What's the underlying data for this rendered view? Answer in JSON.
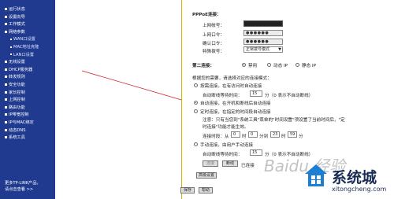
{
  "sidebar": {
    "items": [
      {
        "label": "运行状态",
        "sub": false
      },
      {
        "label": "设置向导",
        "sub": false
      },
      {
        "label": "工作模式",
        "sub": false
      },
      {
        "label": "网络参数",
        "sub": false
      },
      {
        "label": "WAN口设置",
        "sub": true
      },
      {
        "label": "MAC地址克隆",
        "sub": true
      },
      {
        "label": "LAN口设置",
        "sub": true
      },
      {
        "label": "无线设置",
        "sub": false
      },
      {
        "label": "DHCP服务器",
        "sub": false
      },
      {
        "label": "转发规则",
        "sub": false
      },
      {
        "label": "安全功能",
        "sub": false
      },
      {
        "label": "家长控制",
        "sub": false
      },
      {
        "label": "上网控制",
        "sub": false
      },
      {
        "label": "路由功能",
        "sub": false
      },
      {
        "label": "IP带宽控制",
        "sub": false
      },
      {
        "label": "IP与MAC绑定",
        "sub": false
      },
      {
        "label": "动态DNS",
        "sub": false
      },
      {
        "label": "系统工具",
        "sub": false
      }
    ],
    "footer_line1": "更多TP-LINK产品，",
    "footer_line2": "请点击查看 >>"
  },
  "form": {
    "pppoe_title": "PPPoE连接：",
    "account_label": "上网帐号：",
    "account_value": "",
    "password_label": "上网口令：",
    "password_value": "●●●●●●",
    "confirm_label": "确认口令：",
    "confirm_value": "●●●●●●",
    "special_label": "特殊拨号：",
    "special_value": "正常拨号模式",
    "second_conn_label": "第二连接：",
    "second_options": [
      "禁用",
      "动态 IP",
      "静态 IP"
    ],
    "mode_prompt": "根据您的需要，请选择对应的连接模式：",
    "ondemand_label": "按需连接，在有访问时自动连接",
    "idle1_label": "自动断线等待时间：",
    "idle1_value": "15",
    "idle1_hint": "分（0 表示不自动断线）",
    "auto_label": "自动连接，在开机和断线后自动连接",
    "timed_label": "定时连接，在指定的时间段自动连接",
    "note_line1": "注意：只有当您到\"系统工具\"菜单的\"时间设置\"项设置了当前时间后，\"定",
    "note_line2": "时连接\"功能才能生效。",
    "period_label": "连接时段：从",
    "time_h1": "0",
    "time_sep1": "时",
    "time_m1": "0",
    "time_sep2": "分到",
    "time_h2": "23",
    "time_sep3": "时",
    "time_m2": "59",
    "time_sep4": "分",
    "manual_label": "手动连接，由用户手动连接",
    "idle2_label": "自动断线等待时间：",
    "idle2_value": "15",
    "idle2_hint": "分（0 表示不自动断线）",
    "connect_btn": "连接",
    "disconnect_btn": "断线",
    "status_text": "已连接",
    "advanced_btn": "高级设置",
    "save_btn": "保存",
    "help_btn": "帮助"
  },
  "watermark": "Baidu 经验",
  "logo": {
    "text": "系统城",
    "url": "xitongcheng.com"
  },
  "colors": {
    "sidebar_bg": "#1f3a8f",
    "content_border": "#d9b200",
    "annotation_red": "#d42020"
  }
}
